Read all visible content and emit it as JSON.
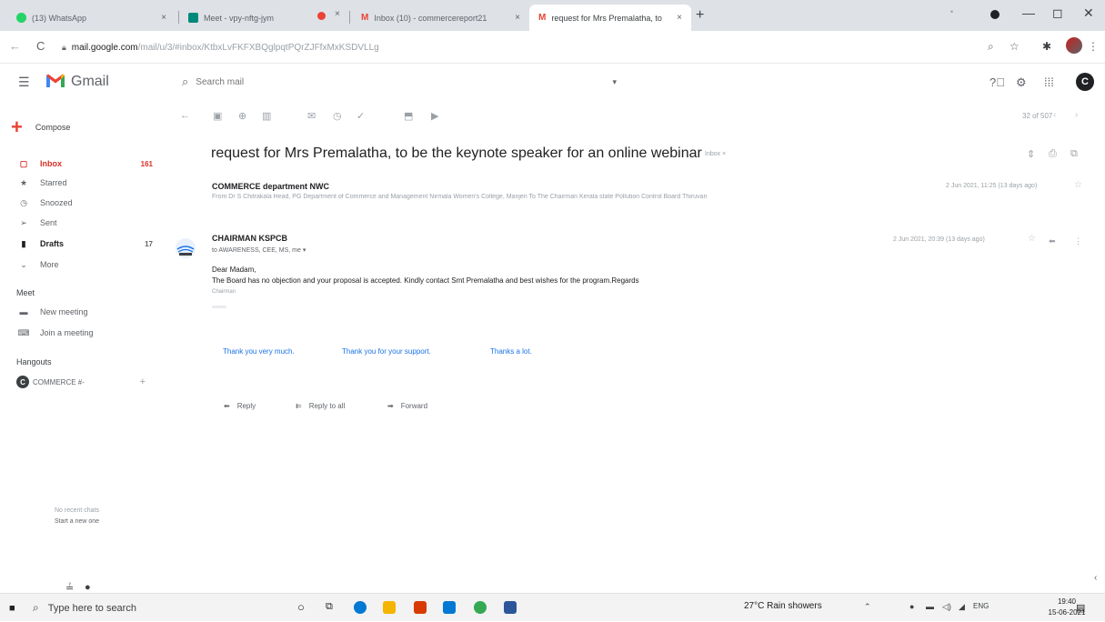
{
  "browser": {
    "tabs": [
      {
        "label": "(13) WhatsApp",
        "color": "#25d366",
        "close": "×"
      },
      {
        "label": "Meet - vpy-nftg-jym",
        "color": "#00897b",
        "close": "×"
      },
      {
        "label": "Inbox (10) - commercereport21",
        "color": "#ea4335",
        "close": "×"
      },
      {
        "label": "request for Mrs Premalatha, to",
        "color": "#ea4335",
        "close": "×"
      }
    ],
    "recording_close": "×",
    "new_tab": "+",
    "window_controls": {
      "minimize": "—",
      "restore": "◻",
      "close": "✕"
    },
    "address": {
      "host": "mail.google.com",
      "path": "/mail/u/3/#inbox/KtbxLvFKFXBQglpqtPQrZJFfxMxKSDVLLg"
    },
    "nav": {
      "back": "←",
      "reload": "C"
    }
  },
  "gmail": {
    "app_name": "Gmail",
    "search_placeholder": "Search mail",
    "compose_label": "Compose",
    "sidebar": [
      {
        "label": "Inbox",
        "count": "161",
        "icon": "▢"
      },
      {
        "label": "Starred",
        "count": "",
        "icon": "★"
      },
      {
        "label": "Snoozed",
        "count": "",
        "icon": "◷"
      },
      {
        "label": "Sent",
        "count": "",
        "icon": "➢"
      },
      {
        "label": "Drafts",
        "count": "17",
        "icon": "▮"
      },
      {
        "label": "More",
        "count": "",
        "icon": "⌄"
      }
    ],
    "meet": {
      "heading": "Meet",
      "new_meeting": "New meeting",
      "join_meeting": "Join a meeting"
    },
    "hangouts": {
      "heading": "Hangouts",
      "contact_initial": "C",
      "contact": "COMMERCE #-",
      "recent_1": "No recent chats",
      "recent_2": "Start a new one"
    },
    "pager": "32 of 507",
    "user_initial": "C"
  },
  "message": {
    "subject": "request for Mrs Premalatha, to be the keynote speaker for an online webinar",
    "label_chip": "Inbox ×",
    "thread": [
      {
        "sender": "COMMERCE department NWC",
        "snippet": "From Dr S Chitrakala Head, PG Department of Commerce and Management Nirmala Women's College, Manjeri To The Chairman Kerala state Pollution Control Board Thiruvan",
        "date": "2 Jun 2021, 11:25 (13 days ago)"
      },
      {
        "sender": "CHAIRMAN KSPCB",
        "to": "to AWARENESS, CEE, MS, me ▾",
        "date": "2 Jun 2021, 20:39 (13 days ago)",
        "greeting": "Dear Madam,",
        "body": "The Board has no objection and your proposal is accepted. Kindly contact  Smt Premalatha and best wishes for the program.Regards",
        "signature": "Chairman"
      }
    ],
    "smart_replies": [
      "Thank you very much.",
      "Thank you for your support.",
      "Thanks a lot."
    ],
    "actions": {
      "reply": "Reply",
      "reply_all": "Reply to all",
      "forward": "Forward"
    }
  },
  "taskbar": {
    "search_placeholder": "Type here to search",
    "weather": "27°C  Rain showers",
    "lang": "ENG",
    "time": "19:40",
    "date": "15-06-2021"
  }
}
